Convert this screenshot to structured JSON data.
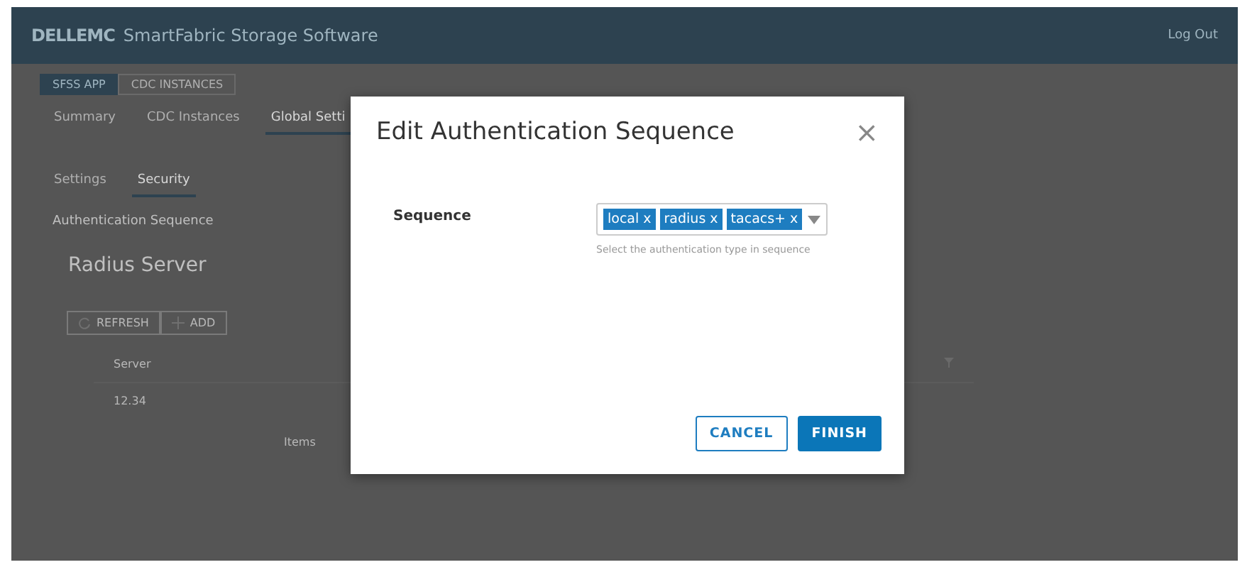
{
  "header": {
    "logo": "DELLEMC",
    "title": "SmartFabric Storage Software",
    "logout": "Log Out"
  },
  "app_tabs": [
    {
      "label": "SFSS APP",
      "selected": true
    },
    {
      "label": "CDC INSTANCES",
      "selected": false
    }
  ],
  "nav_tabs": [
    {
      "label": "Summary",
      "selected": false
    },
    {
      "label": "CDC Instances",
      "selected": false
    },
    {
      "label": "Global Setti",
      "selected": true
    }
  ],
  "sub_tabs": [
    {
      "label": "Settings",
      "selected": false
    },
    {
      "label": "Security",
      "selected": true
    }
  ],
  "section_label": "Authentication Sequence",
  "panel": {
    "title": "Radius Server",
    "buttons": [
      {
        "kind": "refresh",
        "label": "REFRESH"
      },
      {
        "kind": "add",
        "label": "ADD"
      }
    ],
    "table": {
      "columns": [
        "Server"
      ],
      "rows": [
        [
          "12.34"
        ]
      ]
    },
    "pager_label": "Items"
  },
  "dialog": {
    "title": "Edit Authentication Sequence",
    "close": "×",
    "field_label": "Sequence",
    "chips": [
      {
        "label": "local",
        "remove": "x"
      },
      {
        "label": "radius",
        "remove": "x"
      },
      {
        "label": "tacacs+",
        "remove": "x"
      }
    ],
    "hint": "Select the authentication type in sequence",
    "buttons": [
      {
        "kind": "secondary",
        "label": "CANCEL"
      },
      {
        "kind": "primary",
        "label": "FINISH"
      }
    ]
  }
}
